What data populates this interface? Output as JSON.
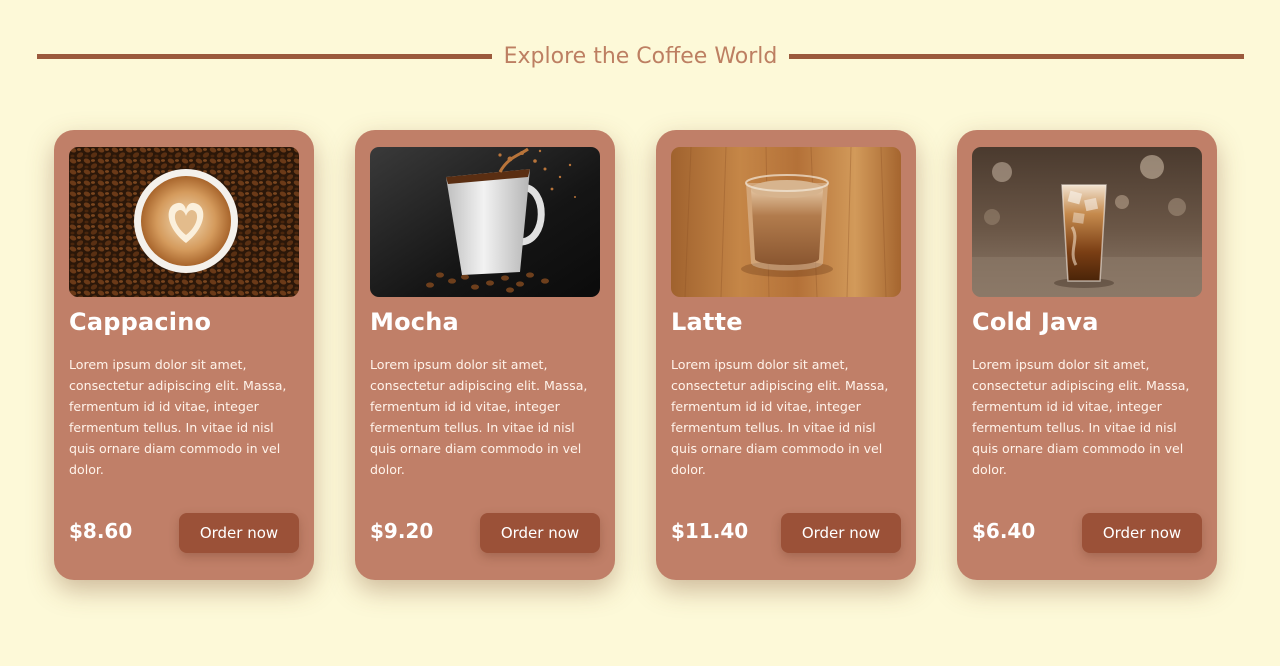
{
  "header": {
    "title": "Explore the Coffee World"
  },
  "colors": {
    "background": "#fdf9d8",
    "card": "#c07f68",
    "accent": "#9b5a3c",
    "title": "#bd7f62",
    "button": "#9b5138"
  },
  "cards": [
    {
      "name": "Cappacino",
      "description": "Lorem ipsum dolor sit amet, consectetur adipiscing elit. Massa, fermentum id id vitae, integer fermentum tellus. In vitae id nisl quis ornare diam commodo in vel dolor.",
      "price": "$8.60",
      "button_label": "Order now",
      "image": "cappuccino-latte-art-on-coffee-beans"
    },
    {
      "name": "Mocha",
      "description": "Lorem ipsum dolor sit amet, consectetur adipiscing elit. Massa, fermentum id id vitae, integer fermentum tellus. In vitae id nisl quis ornare diam commodo in vel dolor.",
      "price": "$9.20",
      "button_label": "Order now",
      "image": "white-mug-splashing-over-beans"
    },
    {
      "name": "Latte",
      "description": "Lorem ipsum dolor sit amet, consectetur adipiscing elit. Massa, fermentum id id vitae, integer fermentum tellus. In vitae id nisl quis ornare diam commodo in vel dolor.",
      "price": "$11.40",
      "button_label": "Order now",
      "image": "glass-latte-on-wooden-table"
    },
    {
      "name": "Cold Java",
      "description": "Lorem ipsum dolor sit amet, consectetur adipiscing elit. Massa, fermentum id id vitae, integer fermentum tellus. In vitae id nisl quis ornare diam commodo in vel dolor.",
      "price": "$6.40",
      "button_label": "Order now",
      "image": "iced-coffee-glass-in-cafe"
    }
  ]
}
